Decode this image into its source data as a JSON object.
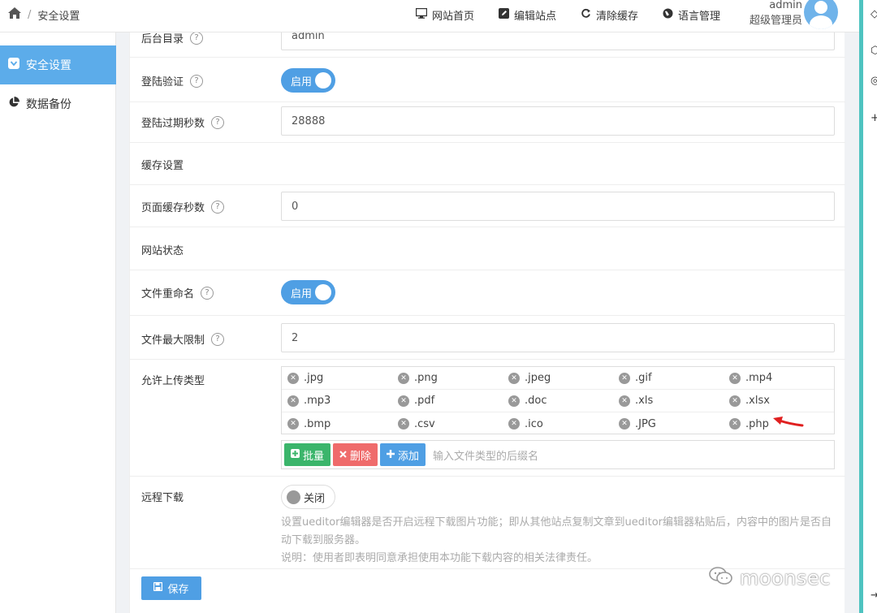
{
  "breadcrumb": {
    "home_icon": "home-icon",
    "separator": "/",
    "current": "安全设置"
  },
  "topnav": [
    {
      "label": "网站首页",
      "icon": "monitor-icon"
    },
    {
      "label": "编辑站点",
      "icon": "edit-icon"
    },
    {
      "label": "清除缓存",
      "icon": "refresh-icon"
    },
    {
      "label": "语言管理",
      "icon": "globe-icon"
    }
  ],
  "user": {
    "name": "admin",
    "role": "超级管理员"
  },
  "sidebar": {
    "items": [
      {
        "label": "安全设置",
        "icon": "shield-icon",
        "active": true
      },
      {
        "label": "数据备份",
        "icon": "pie-chart-icon",
        "active": false
      }
    ]
  },
  "form": {
    "admin_dir": {
      "label": "后台目录",
      "value": "admin"
    },
    "login_verify": {
      "label": "登陆验证",
      "state": "启用"
    },
    "login_expire": {
      "label": "登陆过期秒数",
      "value": "28888"
    },
    "cache_section": "缓存设置",
    "page_cache": {
      "label": "页面缓存秒数",
      "value": "0"
    },
    "status_section": "网站状态",
    "file_rename": {
      "label": "文件重命名",
      "state": "启用"
    },
    "file_max": {
      "label": "文件最大限制",
      "value": "2"
    },
    "upload_types": {
      "label": "允许上传类型",
      "rows": [
        [
          ".jpg",
          ".png",
          ".jpeg",
          ".gif",
          ".mp4"
        ],
        [
          ".mp3",
          ".pdf",
          ".doc",
          ".xls",
          ".xlsx"
        ],
        [
          ".bmp",
          ".csv",
          ".ico",
          ".JPG",
          ".php"
        ]
      ],
      "buttons": {
        "batch": "批量",
        "delete": "删除",
        "add": "添加"
      },
      "placeholder": "输入文件类型的后缀名"
    },
    "remote_download": {
      "label": "远程下载",
      "state": "关闭",
      "help1": "设置ueditor编辑器是否开启远程下载图片功能；即从其他站点复制文章到ueditor编辑器粘贴后，内容中的图片是否自动下载到服务器。",
      "help2": "说明：使用者即表明同意承担使用本功能下载内容的相关法律责任。"
    },
    "save_label": "保存"
  },
  "watermark": "moonsec",
  "colors": {
    "accent": "#4f9fe4",
    "sidebar_active": "#5cacea",
    "green": "#3bb56b",
    "red": "#ef6b6b",
    "annotation": "#e02020"
  }
}
